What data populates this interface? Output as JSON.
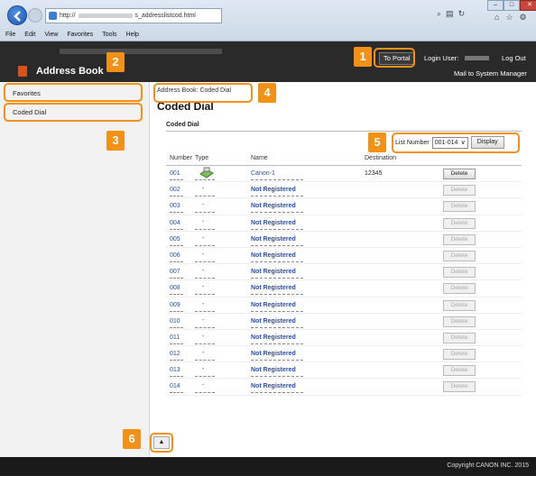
{
  "browser": {
    "url_prefix": "http://",
    "url_suffix": "s_addresslistcod.html",
    "menu": [
      "File",
      "Edit",
      "View",
      "Favorites",
      "Tools",
      "Help"
    ]
  },
  "header": {
    "title": "Address Book",
    "to_portal": "To Portal",
    "login_label": "Login User:",
    "logout": "Log Out",
    "mail": "Mail to System Manager"
  },
  "sidebar": {
    "items": [
      {
        "label": "Favorites"
      },
      {
        "label": "Coded Dial"
      }
    ]
  },
  "main": {
    "breadcrumb": "Address Book: Coded Dial",
    "title": "Coded Dial",
    "subtitle": "Coded Dial",
    "list_number_label": "List Number",
    "list_number_value": "001-014",
    "display_button": "Display",
    "columns": [
      "Number",
      "Type",
      "Name",
      "Destination"
    ],
    "delete_label": "Delete",
    "rows": [
      {
        "number": "001",
        "type_icon": "fax-icon",
        "name": "Canon-1",
        "destination": "12345"
      },
      {
        "number": "002",
        "type": "-",
        "name": "Not Registered",
        "destination": ""
      },
      {
        "number": "003",
        "type": "-",
        "name": "Not Registered",
        "destination": ""
      },
      {
        "number": "004",
        "type": "-",
        "name": "Not Registered",
        "destination": ""
      },
      {
        "number": "005",
        "type": "-",
        "name": "Not Registered",
        "destination": ""
      },
      {
        "number": "006",
        "type": "-",
        "name": "Not Registered",
        "destination": ""
      },
      {
        "number": "007",
        "type": "-",
        "name": "Not Registered",
        "destination": ""
      },
      {
        "number": "008",
        "type": "-",
        "name": "Not Registered",
        "destination": ""
      },
      {
        "number": "009",
        "type": "-",
        "name": "Not Registered",
        "destination": ""
      },
      {
        "number": "010",
        "type": "-",
        "name": "Not Registered",
        "destination": ""
      },
      {
        "number": "011",
        "type": "-",
        "name": "Not Registered",
        "destination": ""
      },
      {
        "number": "012",
        "type": "-",
        "name": "Not Registered",
        "destination": ""
      },
      {
        "number": "013",
        "type": "-",
        "name": "Not Registered",
        "destination": ""
      },
      {
        "number": "014",
        "type": "-",
        "name": "Not Registered",
        "destination": ""
      }
    ]
  },
  "footer": {
    "copyright": "Copyright CANON INC. 2015"
  },
  "callouts": [
    "1",
    "2",
    "3",
    "4",
    "5",
    "6"
  ],
  "colors": {
    "callout": "#f29116",
    "header_bg": "#2a2a2a",
    "link": "#2b4ea8"
  }
}
